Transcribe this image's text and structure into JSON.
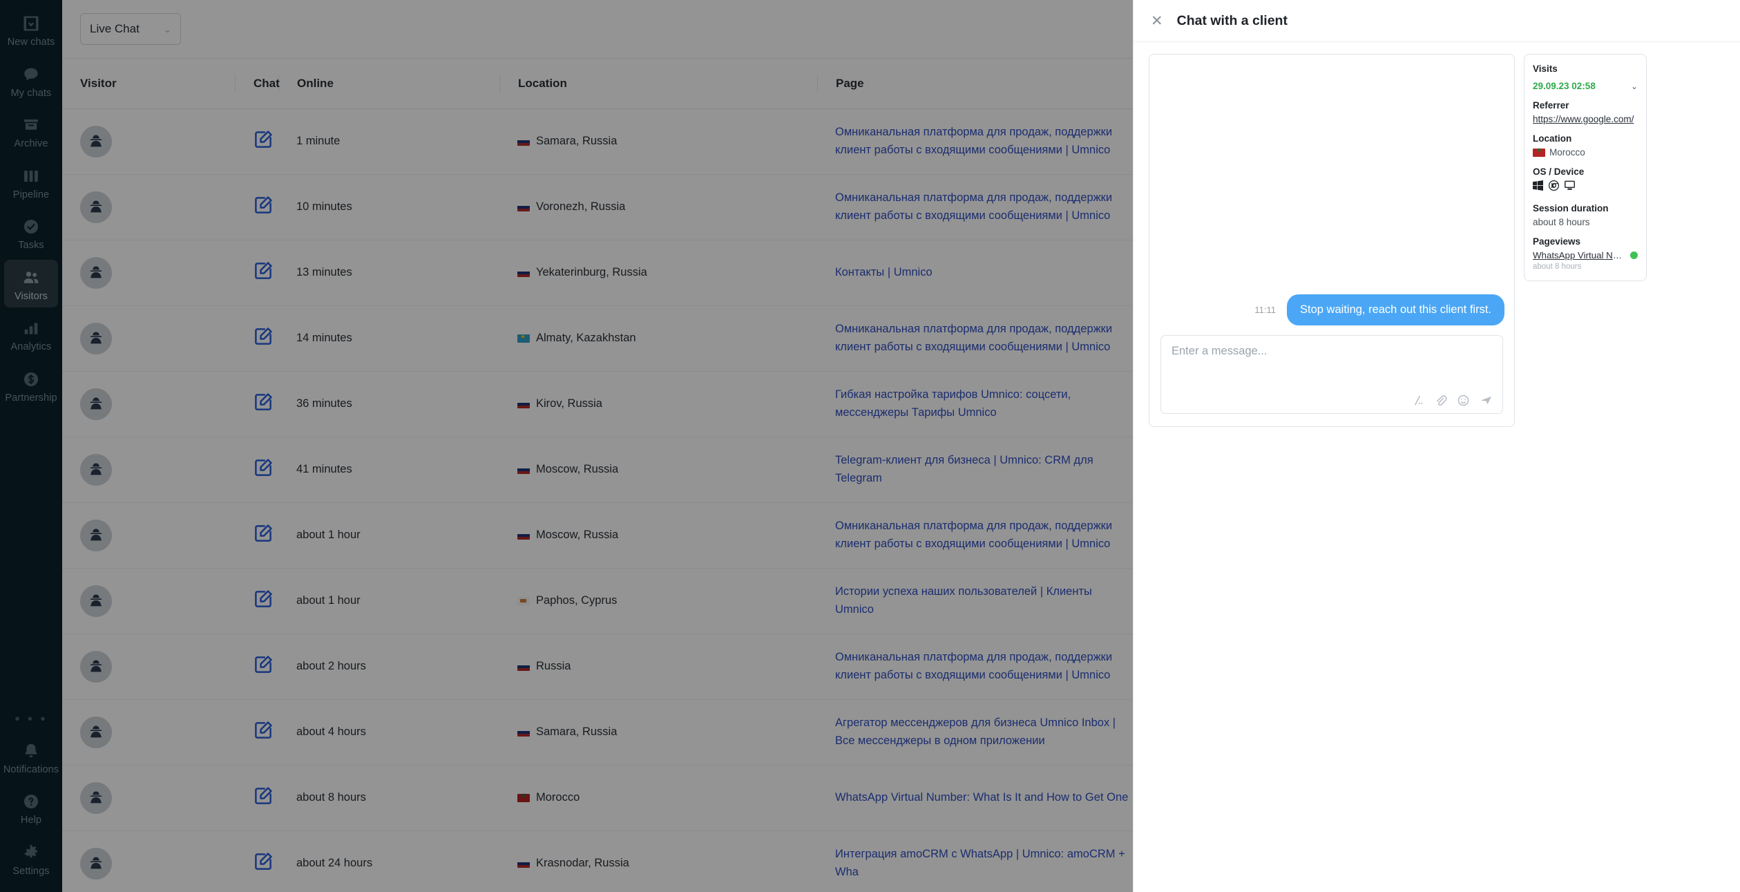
{
  "nav": {
    "items": [
      {
        "label": "New chats",
        "icon": "inbox-download-icon",
        "active": false
      },
      {
        "label": "My chats",
        "icon": "chat-bubble-icon",
        "active": false
      },
      {
        "label": "Archive",
        "icon": "archive-box-icon",
        "active": false
      },
      {
        "label": "Pipeline",
        "icon": "pipeline-columns-icon",
        "active": false
      },
      {
        "label": "Tasks",
        "icon": "check-circle-icon",
        "active": false
      },
      {
        "label": "Visitors",
        "icon": "people-icon",
        "active": true
      },
      {
        "label": "Analytics",
        "icon": "bar-chart-icon",
        "active": false
      },
      {
        "label": "Partnership",
        "icon": "dollar-circle-icon",
        "active": false
      }
    ],
    "more_dots": "• • •",
    "bottom_items": [
      {
        "label": "Notifications",
        "icon": "bell-icon"
      },
      {
        "label": "Help",
        "icon": "question-circle-icon"
      },
      {
        "label": "Settings",
        "icon": "gear-icon"
      }
    ]
  },
  "toolbar": {
    "filter_value": "Live Chat",
    "chevron": "⌄"
  },
  "table": {
    "headers": [
      "Visitor",
      "Chat",
      "Online",
      "Location",
      "Page"
    ],
    "rows": [
      {
        "online": "1 minute",
        "location": "Samara, Russia",
        "flag": "ru",
        "page": "Омниканальная платформа для продаж, поддержки клиент работы с входящими сообщениями | Umnico"
      },
      {
        "online": "10 minutes",
        "location": "Voronezh, Russia",
        "flag": "ru",
        "page": "Омниканальная платформа для продаж, поддержки клиент работы с входящими сообщениями | Umnico"
      },
      {
        "online": "13 minutes",
        "location": "Yekaterinburg, Russia",
        "flag": "ru",
        "page": "Контакты | Umnico"
      },
      {
        "online": "14 minutes",
        "location": "Almaty, Kazakhstan",
        "flag": "kz",
        "page": "Омниканальная платформа для продаж, поддержки клиент работы с входящими сообщениями | Umnico"
      },
      {
        "online": "36 minutes",
        "location": "Kirov, Russia",
        "flag": "ru",
        "page": "Гибкая настройка тарифов Umnico: соцсети, мессенджеры Тарифы Umnico"
      },
      {
        "online": "41 minutes",
        "location": "Moscow, Russia",
        "flag": "ru",
        "page": "Telegram-клиент для бизнеса | Umnico: CRM для Telegram"
      },
      {
        "online": "about 1 hour",
        "location": "Moscow, Russia",
        "flag": "ru",
        "page": "Омниканальная платформа для продаж, поддержки клиент работы с входящими сообщениями | Umnico"
      },
      {
        "online": "about 1 hour",
        "location": "Paphos, Cyprus",
        "flag": "cy",
        "page": "Истории успеха наших пользователей | Клиенты Umnico"
      },
      {
        "online": "about 2 hours",
        "location": "Russia",
        "flag": "ru",
        "page": "Омниканальная платформа для продаж, поддержки клиент работы с входящими сообщениями | Umnico"
      },
      {
        "online": "about 4 hours",
        "location": "Samara, Russia",
        "flag": "ru",
        "page": "Агрегатор мессенджеров для бизнеса Umnico Inbox | Все мессенджеры в одном приложении"
      },
      {
        "online": "about 8 hours",
        "location": "Morocco",
        "flag": "ma",
        "page": "WhatsApp Virtual Number: What Is It and How to Get One"
      },
      {
        "online": "about 24 hours",
        "location": "Krasnodar, Russia",
        "flag": "ru",
        "page": "Интеграция amoCRM с WhatsApp | Umnico: amoCRM + Wha"
      }
    ]
  },
  "panel": {
    "title": "Chat with a client",
    "close_label": "✕",
    "chat": {
      "message_time": "11:11",
      "message_text": "Stop waiting, reach out this client first.",
      "composer_placeholder": "Enter a message...",
      "composer_icons": [
        "quick-reply-icon",
        "attachment-icon",
        "emoji-icon",
        "send-icon"
      ]
    },
    "info": {
      "visits_heading": "Visits",
      "visit_date": "29.09.23 02:58",
      "visit_chevron": "⌄",
      "referrer_heading": "Referrer",
      "referrer_url": "https://www.google.com/",
      "location_heading": "Location",
      "location_value": "Morocco",
      "os_heading": "OS / Device",
      "os_icons": [
        "windows-icon",
        "chrome-icon",
        "desktop-icon"
      ],
      "session_heading": "Session duration",
      "session_value": "about 8 hours",
      "pageviews_heading": "Pageviews",
      "pageview_title": "WhatsApp Virtual Number: ...",
      "pageview_time": "about 8 hours"
    }
  },
  "colors": {
    "nav_bg": "#0b222b",
    "accent_blue": "#2b5fd9",
    "bubble_blue": "#4ba7f5",
    "link_blue": "#2f4fc0",
    "green": "#2faa4b",
    "dot_green": "#3ec254"
  }
}
